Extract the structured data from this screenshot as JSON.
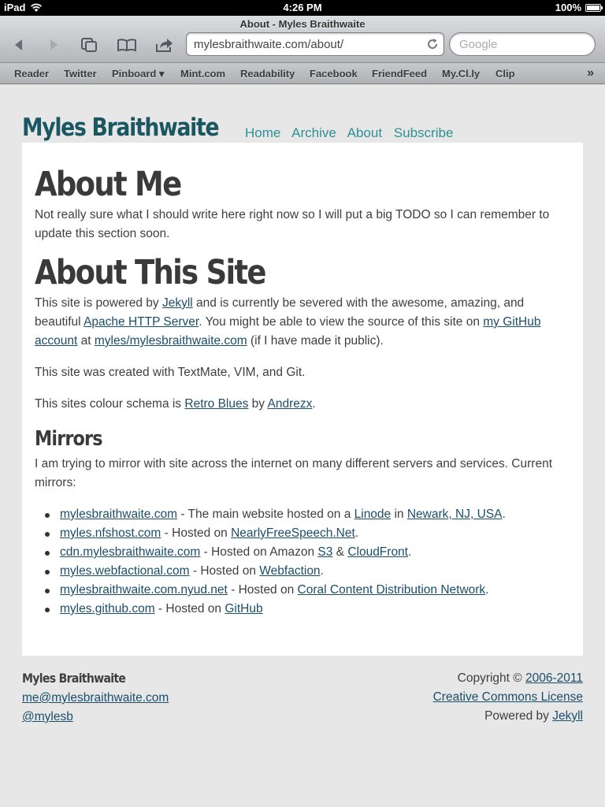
{
  "status_bar": {
    "carrier": "iPad",
    "time": "4:26 PM",
    "battery": "100%"
  },
  "browser": {
    "title": "About - Myles Braithwaite",
    "url": "mylesbraithwaite.com/about/",
    "search_placeholder": "Google",
    "bookmarks": [
      "Reader",
      "Twitter",
      "Pinboard ▾",
      "Mint.com",
      "Readability",
      "Facebook",
      "FriendFeed",
      "My.Cl.ly",
      "Clip"
    ],
    "more": "»"
  },
  "site": {
    "title": "Myles Braithwaite",
    "nav": [
      "Home",
      "Archive",
      "About",
      "Subscribe"
    ]
  },
  "content": {
    "about_me_heading": "About Me",
    "about_me_text": "Not really sure what I should write here right now so I will put a big TODO so I can remember to update this section soon.",
    "about_site_heading": "About This Site",
    "about_site_p1": {
      "t1": "This site is powered by ",
      "l1": "Jekyll",
      "t2": " and is currently be severed with the awesome, amazing, and beautiful ",
      "l2": "Apache HTTP Server",
      "t3": ". You might be able to view the source of this site on ",
      "l3": "my GitHub account",
      "t4": " at ",
      "l4": "myles/mylesbraithwaite.com",
      "t5": " (if I have made it public)."
    },
    "about_site_p2": "This site was created with TextMate, VIM, and Git.",
    "about_site_p3": {
      "t1": "This sites colour schema is ",
      "l1": "Retro Blues",
      "t2": " by ",
      "l2": "Andrezx",
      "t3": "."
    },
    "mirrors_heading": "Mirrors",
    "mirrors_intro": "I am trying to mirror with site across the internet on many different servers and services. Current mirrors:",
    "mirrors": [
      {
        "host": "mylesbraithwaite.com",
        "t1": " - The main website hosted on a ",
        "l1": "Linode",
        "t2": " in ",
        "l2": "Newark, NJ, USA",
        "t3": "."
      },
      {
        "host": "myles.nfshost.com",
        "t1": " - Hosted on ",
        "l1": "NearlyFreeSpeech.Net",
        "t2": ".",
        "l2": "",
        "t3": ""
      },
      {
        "host": "cdn.mylesbraithwaite.com",
        "t1": " - Hosted on Amazon ",
        "l1": "S3",
        "t2": " & ",
        "l2": "CloudFront",
        "t3": "."
      },
      {
        "host": "myles.webfactional.com",
        "t1": " - Hosted on ",
        "l1": "Webfaction",
        "t2": ".",
        "l2": "",
        "t3": ""
      },
      {
        "host": "mylesbraithwaite.com.nyud.net",
        "t1": " - Hosted on ",
        "l1": "Coral Content Distribution Network",
        "t2": ".",
        "l2": "",
        "t3": ""
      },
      {
        "host": "myles.github.com",
        "t1": " - Hosted on ",
        "l1": "GitHub",
        "t2": "",
        "l2": "",
        "t3": ""
      }
    ]
  },
  "footer": {
    "name": "Myles Braithwaite",
    "email": "me@mylesbraithwaite.com",
    "twitter": "@mylesb",
    "copyright_prefix": "Copyright © ",
    "copyright_years": "2006-2011",
    "license": "Creative Commons License",
    "powered_prefix": "Powered by ",
    "powered_link": "Jekyll"
  },
  "colors": {
    "title": "#1a5761",
    "nav": "#2f8f95",
    "link": "#1a4e6a",
    "page_bg": "#e7e7e7"
  }
}
